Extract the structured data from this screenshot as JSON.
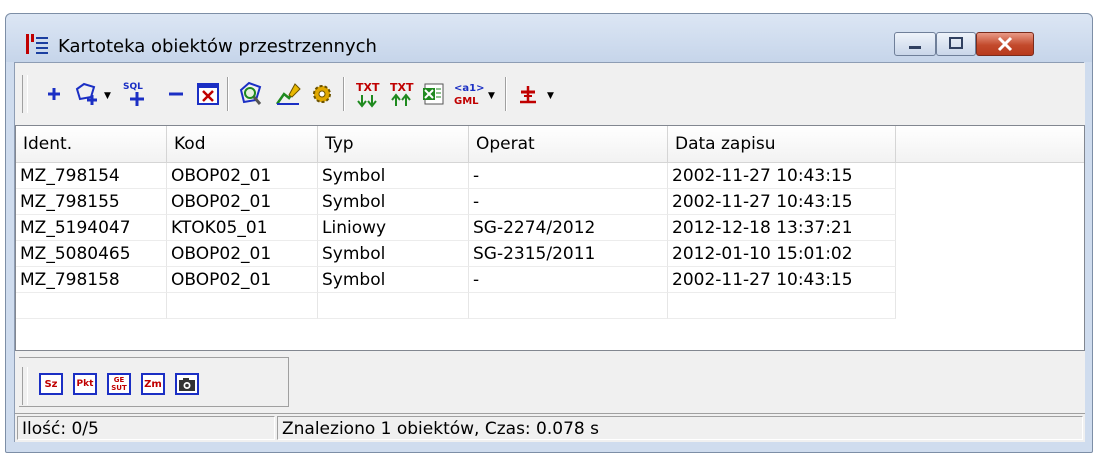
{
  "window": {
    "title": "Kartoteka obiektów przestrzennych"
  },
  "toolbar": {
    "sql_label": "SQL",
    "txt1_label": "TXT",
    "txt2_label": "TXT",
    "gml_tag_label": "<a1>",
    "gml_label": "GML"
  },
  "table": {
    "columns": [
      "Ident.",
      "Kod",
      "Typ",
      "Operat",
      "Data zapisu"
    ],
    "rows": [
      [
        "MZ_798154",
        "OBOP02_01",
        "Symbol",
        "-",
        "2002-11-27 10:43:15"
      ],
      [
        "MZ_798155",
        "OBOP02_01",
        "Symbol",
        "-",
        "2002-11-27 10:43:15"
      ],
      [
        "MZ_5194047",
        "KTOK05_01",
        "Liniowy",
        "SG-2274/2012",
        "2012-12-18 13:37:21"
      ],
      [
        "MZ_5080465",
        "OBOP02_01",
        "Symbol",
        "SG-2315/2011",
        "2012-01-10 15:01:02"
      ],
      [
        "MZ_798158",
        "OBOP02_01",
        "Symbol",
        "-",
        "2002-11-27 10:43:15"
      ]
    ]
  },
  "bottom_toolbar": {
    "items": [
      "Sz",
      "Pkt",
      "GE SUT",
      "Zm",
      "camera-icon"
    ]
  },
  "status": {
    "count": "Ilość: 0/5",
    "message": "Znaleziono 1 obiektów, Czas: 0.078 s"
  },
  "colors": {
    "accent": "#1b2fc4",
    "red": "#c00000",
    "green": "#1f8a1f"
  }
}
